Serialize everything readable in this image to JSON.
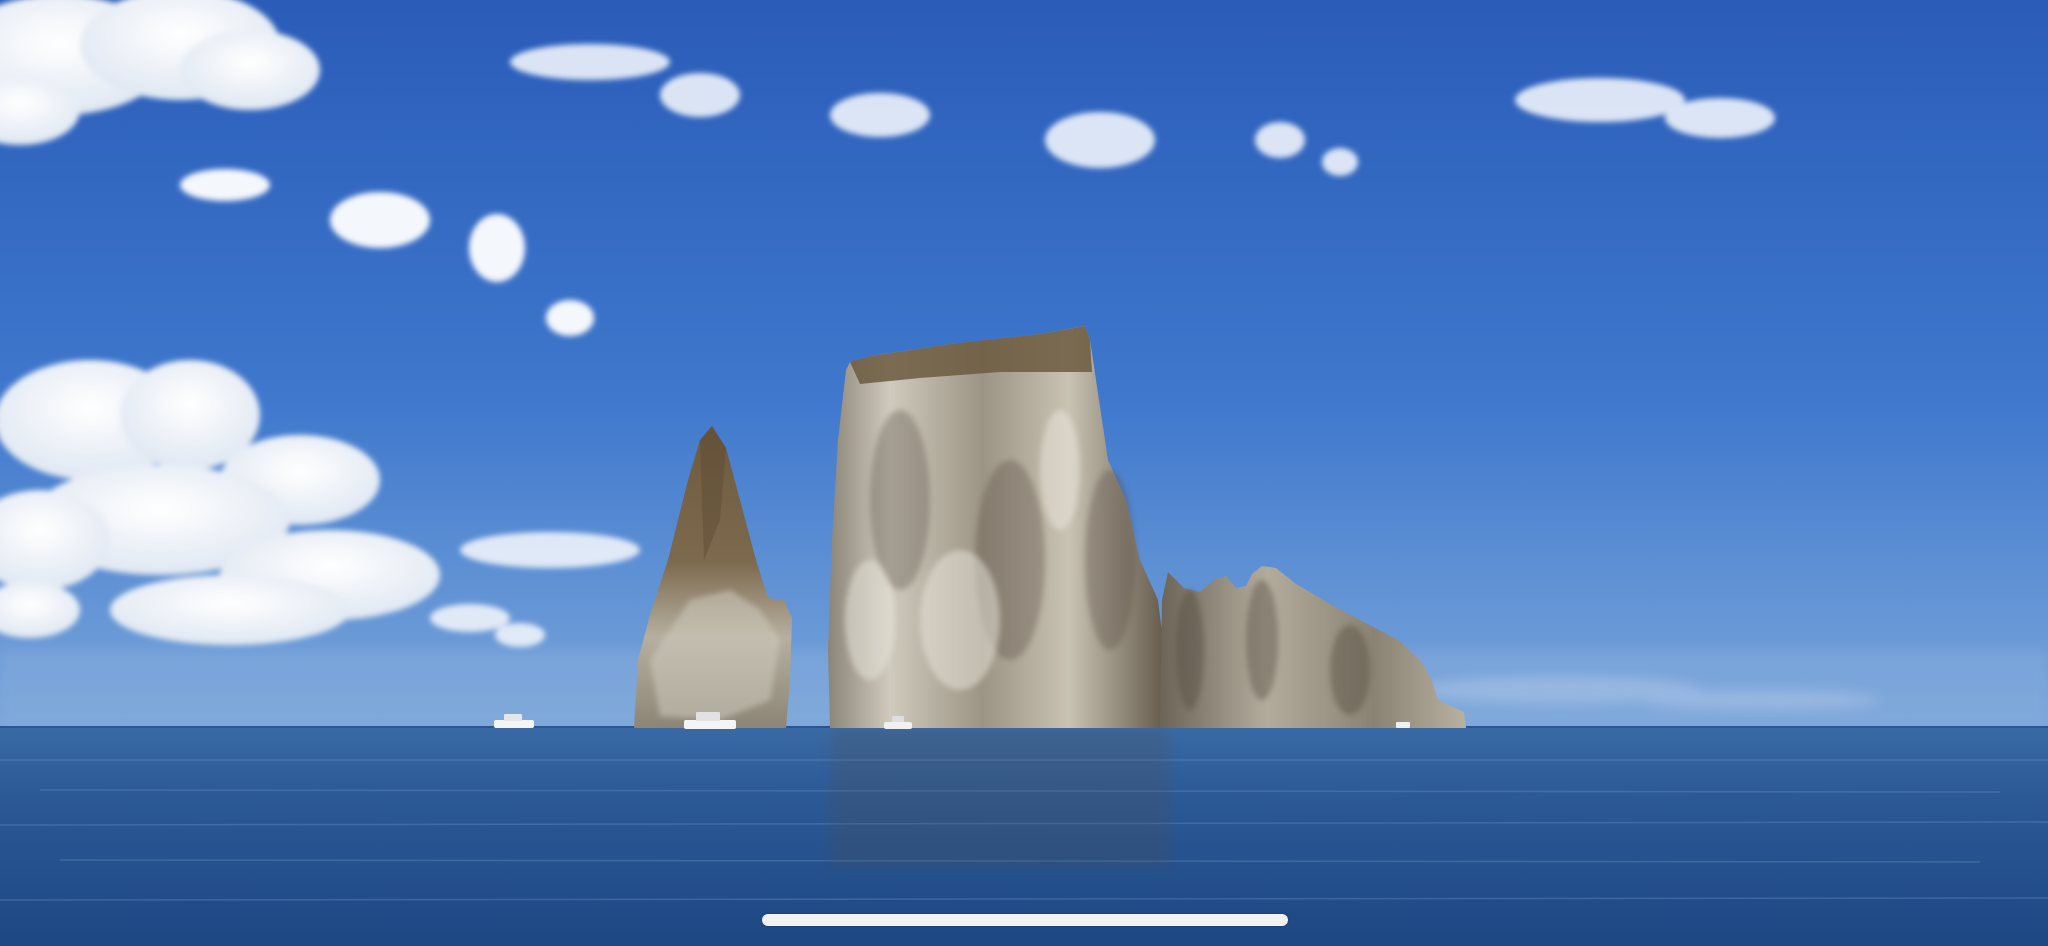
{
  "photo": {
    "subject": "",
    "colors": {
      "sky_top": "#2f63bd",
      "sky_horizon": "#6f9fd8",
      "sea_far": "#2f5f9c",
      "sea_near": "#1e4a86",
      "rock_light": "#b9b3a6",
      "rock_dark": "#4e4336",
      "rock_top": "#6b5a40",
      "cloud": "#ffffff"
    }
  },
  "system": {
    "home_indicator_color": "#f2f2f2"
  }
}
